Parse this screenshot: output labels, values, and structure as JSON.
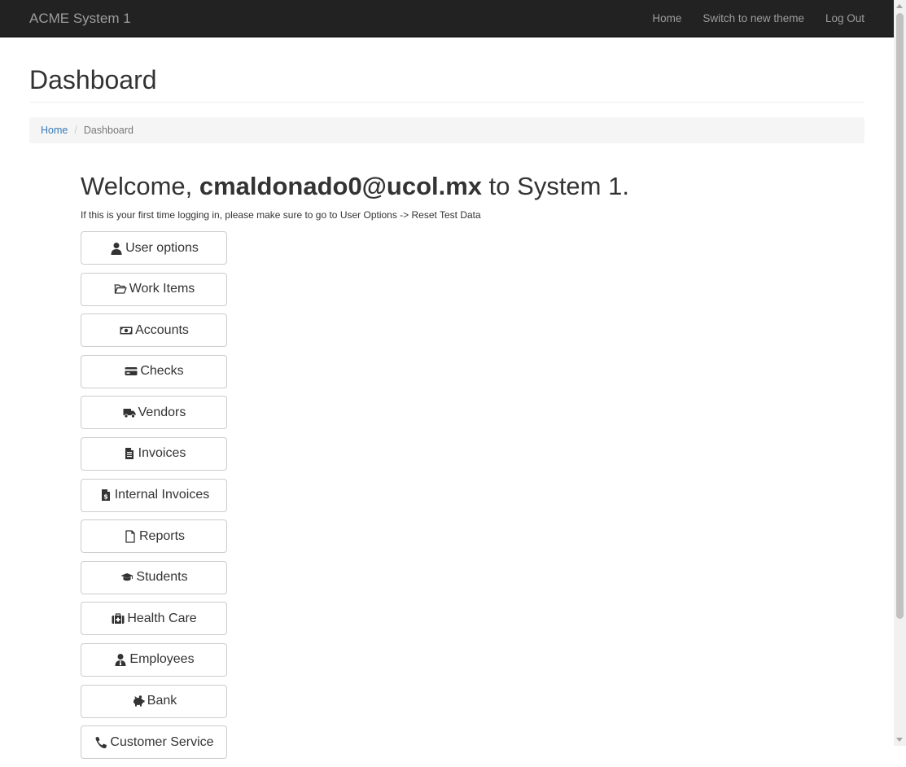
{
  "navbar": {
    "brand": "ACME System 1",
    "links": [
      "Home",
      "Switch to new theme",
      "Log Out"
    ]
  },
  "page": {
    "title": "Dashboard"
  },
  "breadcrumb": {
    "home": "Home",
    "current": "Dashboard"
  },
  "welcome": {
    "prefix": "Welcome, ",
    "user": "cmaldonado0@ucol.mx",
    "suffix": " to System 1.",
    "hint": "If this is your first time logging in, please make sure to go to User Options -> Reset Test Data"
  },
  "menu": [
    {
      "label": "User options",
      "icon": "user-icon"
    },
    {
      "label": "Work Items",
      "icon": "folder-open-icon"
    },
    {
      "label": "Accounts",
      "icon": "money-bill-icon"
    },
    {
      "label": "Checks",
      "icon": "credit-card-icon"
    },
    {
      "label": "Vendors",
      "icon": "truck-icon"
    },
    {
      "label": "Invoices",
      "icon": "file-invoice-icon"
    },
    {
      "label": "Internal Invoices",
      "icon": "file-invoice-dollar-icon"
    },
    {
      "label": "Reports",
      "icon": "file-icon"
    },
    {
      "label": "Students",
      "icon": "graduation-cap-icon"
    },
    {
      "label": "Health Care",
      "icon": "medkit-icon"
    },
    {
      "label": "Employees",
      "icon": "user-tie-icon"
    },
    {
      "label": "Bank",
      "icon": "piggy-bank-icon"
    },
    {
      "label": "Customer Service",
      "icon": "phone-icon"
    }
  ],
  "colors": {
    "navbar_bg": "#222222",
    "navbar_text": "#9d9d9d",
    "link": "#337ab7",
    "breadcrumb_bg": "#f5f5f5"
  }
}
